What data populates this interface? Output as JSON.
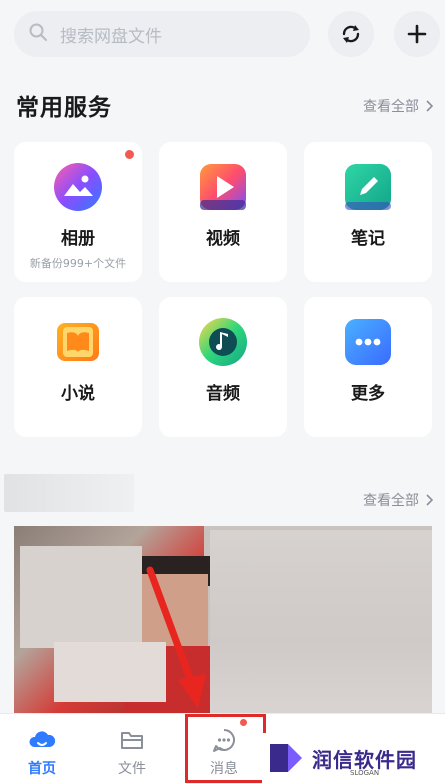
{
  "search": {
    "placeholder": "搜索网盘文件"
  },
  "header_buttons": {
    "sync_icon": "sync-icon",
    "add_icon": "plus-icon"
  },
  "services": {
    "title": "常用服务",
    "see_all": "查看全部",
    "items": [
      {
        "label": "相册",
        "sub": "新备份999+个文件",
        "icon": "album-icon",
        "badge": true
      },
      {
        "label": "视频",
        "sub": "",
        "icon": "video-icon",
        "badge": false
      },
      {
        "label": "笔记",
        "sub": "",
        "icon": "note-icon",
        "badge": false
      },
      {
        "label": "小说",
        "sub": "",
        "icon": "novel-icon",
        "badge": false
      },
      {
        "label": "音频",
        "sub": "",
        "icon": "audio-icon",
        "badge": false
      },
      {
        "label": "更多",
        "sub": "",
        "icon": "more-icon",
        "badge": false
      }
    ]
  },
  "recent": {
    "see_all": "查看全部"
  },
  "bottom_nav": {
    "tabs": [
      {
        "label": "首页",
        "icon": "home-cloud-icon",
        "active": true
      },
      {
        "label": "文件",
        "icon": "folder-icon",
        "active": false
      },
      {
        "label": "消息",
        "icon": "message-icon",
        "active": false,
        "badge": true
      }
    ]
  },
  "watermark": {
    "brand": "润信软件园",
    "slogan": "SLOGAN"
  },
  "colors": {
    "accent": "#2f7bff",
    "badge": "#f25a4f",
    "highlight": "#e02a2a"
  }
}
